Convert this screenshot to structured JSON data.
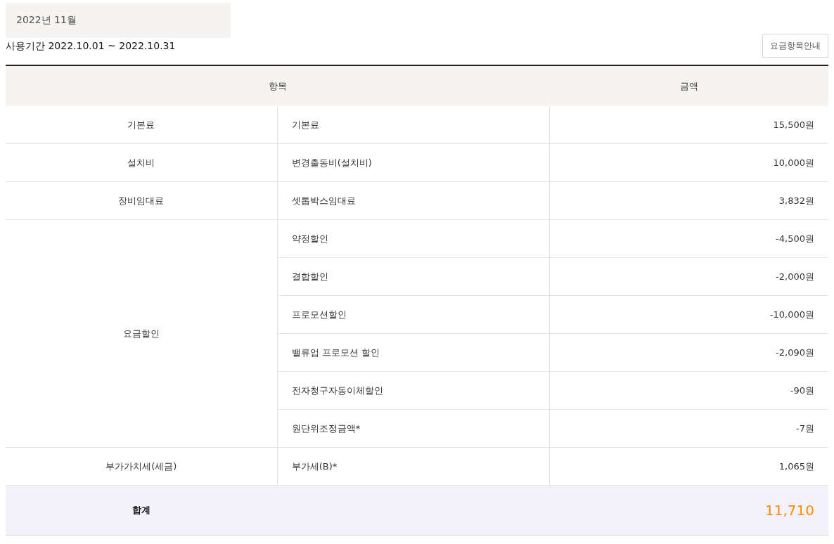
{
  "month_tab": "2022년 11월",
  "usage_period": "사용기간 2022.10.01 ~ 2022.10.31",
  "guide_button": "요금항목안내",
  "table": {
    "columns": [
      "항목",
      "금액"
    ],
    "groups": [
      {
        "category": "기본료",
        "items": [
          {
            "name": "기본료",
            "amount": "15,500원"
          }
        ]
      },
      {
        "category": "설치비",
        "items": [
          {
            "name": "변경출동비(설치비)",
            "amount": "10,000원"
          }
        ]
      },
      {
        "category": "장비임대료",
        "items": [
          {
            "name": "셋톱박스임대료",
            "amount": "3,832원"
          }
        ]
      },
      {
        "category": "요금할인",
        "items": [
          {
            "name": "약정할인",
            "amount": "-4,500원"
          },
          {
            "name": "결합할인",
            "amount": "-2,000원"
          },
          {
            "name": "프로모션할인",
            "amount": "-10,000원"
          },
          {
            "name": "밸류업 프로모션 할인",
            "amount": "-2,090원"
          },
          {
            "name": "전자청구자동이체할인",
            "amount": "-90원"
          },
          {
            "name": "원단위조정금액*",
            "amount": "-7원"
          }
        ]
      },
      {
        "category": "부가가치세(세금)",
        "items": [
          {
            "name": "부가세(B)*",
            "amount": "1,065원"
          }
        ]
      }
    ],
    "total": {
      "label": "합계",
      "amount": "11,710"
    }
  }
}
